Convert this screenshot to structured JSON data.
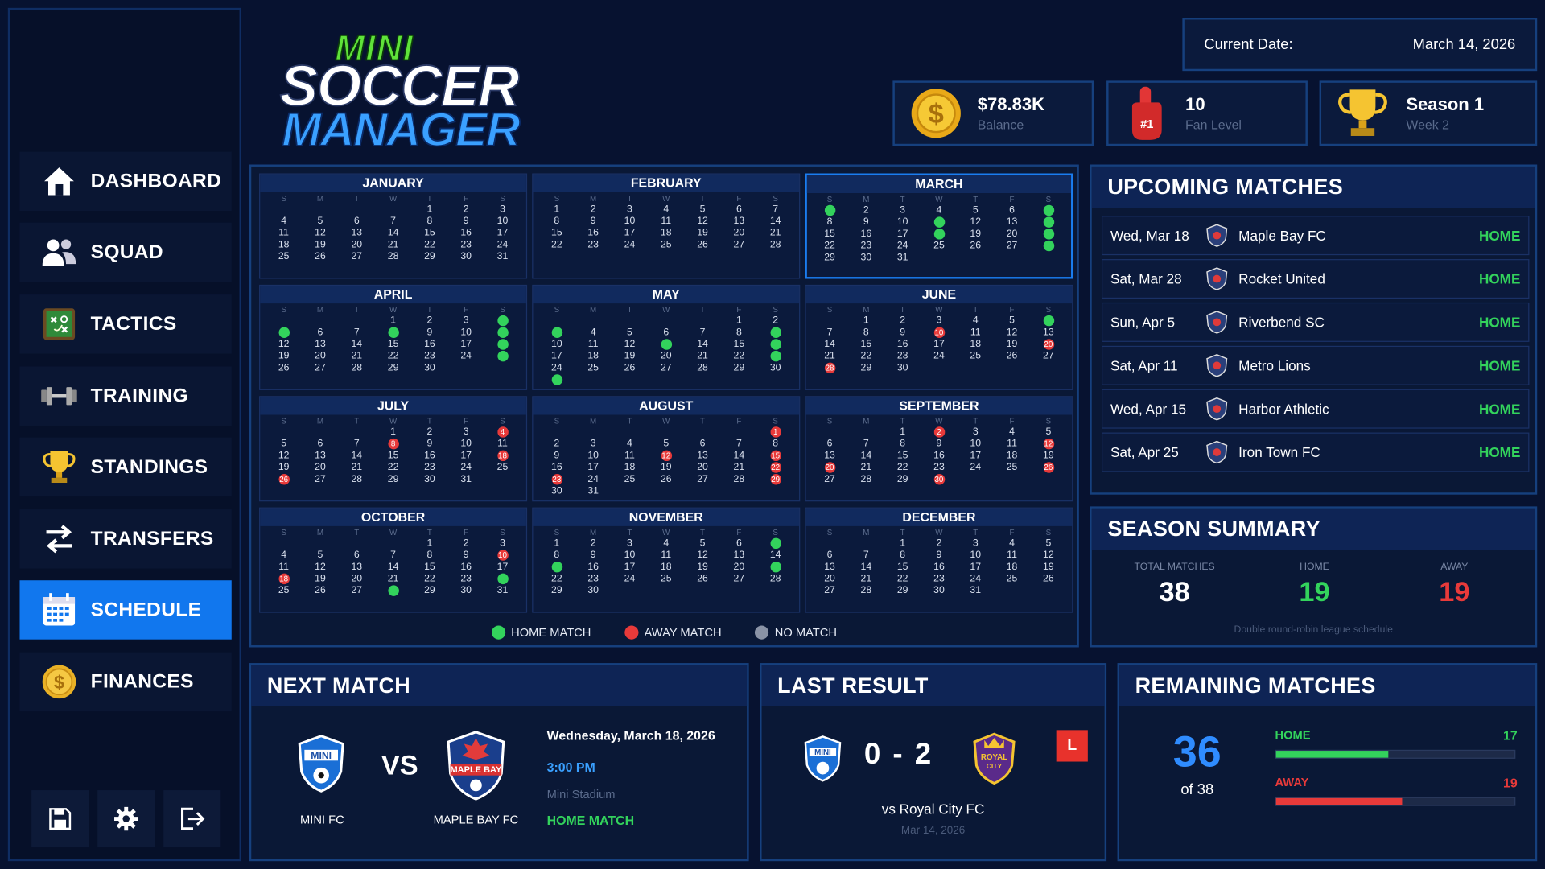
{
  "logo": {
    "line1": "MINI",
    "line2": "SOCCER",
    "line3": "MANAGER"
  },
  "nav": [
    {
      "label": "DASHBOARD",
      "icon": "home-icon"
    },
    {
      "label": "SQUAD",
      "icon": "people-icon"
    },
    {
      "label": "TACTICS",
      "icon": "tactics-board-icon"
    },
    {
      "label": "TRAINING",
      "icon": "dumbbell-icon"
    },
    {
      "label": "STANDINGS",
      "icon": "trophy-icon"
    },
    {
      "label": "TRANSFERS",
      "icon": "transfer-arrows-icon"
    },
    {
      "label": "SCHEDULE",
      "icon": "calendar-icon",
      "active": true
    },
    {
      "label": "FINANCES",
      "icon": "coin-icon"
    }
  ],
  "bottom_buttons": [
    "save-icon",
    "gear-icon",
    "exit-icon"
  ],
  "header": {
    "date_label": "Current Date:",
    "date_value": "March 14, 2026",
    "balance": {
      "value": "$78.83K",
      "label": "Balance"
    },
    "fan": {
      "value": "10",
      "label": "Fan Level",
      "badge": "#1"
    },
    "season": {
      "value": "Season 1",
      "label": "Week 2"
    }
  },
  "calendar": {
    "weekdays": [
      "S",
      "M",
      "T",
      "W",
      "T",
      "F",
      "S"
    ],
    "months": [
      {
        "name": "JANUARY",
        "start": 4,
        "days": 31,
        "home": [],
        "away": []
      },
      {
        "name": "FEBRUARY",
        "start": 0,
        "days": 28,
        "home": [],
        "away": []
      },
      {
        "name": "MARCH",
        "start": 0,
        "days": 31,
        "home": [
          1,
          7,
          11,
          14,
          18,
          21,
          28
        ],
        "away": [],
        "selected": true
      },
      {
        "name": "APRIL",
        "start": 3,
        "days": 30,
        "home": [
          5,
          4,
          8,
          11,
          18,
          25
        ],
        "away": []
      },
      {
        "name": "MAY",
        "start": 5,
        "days": 31,
        "home": [
          3,
          9,
          13,
          16,
          23,
          31
        ],
        "away": []
      },
      {
        "name": "JUNE",
        "start": 1,
        "days": 30,
        "home": [
          6
        ],
        "away": [
          10,
          20,
          28
        ]
      },
      {
        "name": "JULY",
        "start": 3,
        "days": 31,
        "home": [],
        "away": [
          4,
          8,
          18,
          26
        ]
      },
      {
        "name": "AUGUST",
        "start": 6,
        "days": 31,
        "home": [],
        "away": [
          1,
          12,
          15,
          22,
          23,
          29
        ]
      },
      {
        "name": "SEPTEMBER",
        "start": 2,
        "days": 30,
        "home": [],
        "away": [
          2,
          12,
          20,
          26,
          30
        ]
      },
      {
        "name": "OCTOBER",
        "start": 4,
        "days": 31,
        "home": [
          24,
          28
        ],
        "away": [
          10,
          18
        ]
      },
      {
        "name": "NOVEMBER",
        "start": 0,
        "days": 30,
        "home": [
          7,
          15,
          21
        ],
        "away": []
      },
      {
        "name": "DECEMBER",
        "start": 2,
        "days": 31,
        "home": [],
        "away": []
      }
    ],
    "legend": {
      "home": "HOME MATCH",
      "away": "AWAY MATCH",
      "none": "NO MATCH"
    },
    "colors": {
      "home": "#33d35c",
      "away": "#e83a3a",
      "none": "#8a93a6"
    }
  },
  "upcoming": {
    "title": "UPCOMING MATCHES",
    "matches": [
      {
        "date": "Wed, Mar 18",
        "opponent": "Maple Bay FC",
        "venue": "HOME"
      },
      {
        "date": "Sat, Mar 28",
        "opponent": "Rocket United",
        "venue": "HOME"
      },
      {
        "date": "Sun, Apr 5",
        "opponent": "Riverbend SC",
        "venue": "HOME"
      },
      {
        "date": "Sat, Apr 11",
        "opponent": "Metro Lions",
        "venue": "HOME"
      },
      {
        "date": "Wed, Apr 15",
        "opponent": "Harbor Athletic",
        "venue": "HOME"
      },
      {
        "date": "Sat, Apr 25",
        "opponent": "Iron Town FC",
        "venue": "HOME"
      }
    ]
  },
  "summary": {
    "title": "SEASON SUMMARY",
    "total_label": "TOTAL MATCHES",
    "total": "38",
    "home_label": "HOME",
    "home": "19",
    "away_label": "AWAY",
    "away": "19",
    "note": "Double round-robin league schedule"
  },
  "next_match": {
    "title": "NEXT MATCH",
    "home_team": "MINI FC",
    "vs": "VS",
    "away_team": "MAPLE BAY FC",
    "date": "Wednesday, March 18, 2026",
    "time": "3:00 PM",
    "venue": "Mini Stadium",
    "type": "HOME MATCH"
  },
  "last_result": {
    "title": "LAST RESULT",
    "score": "0 - 2",
    "result": "L",
    "opponent": "vs Royal City FC",
    "date": "Mar 14, 2026"
  },
  "remaining": {
    "title": "REMAINING MATCHES",
    "count": "36",
    "of": "of 38",
    "home_label": "HOME",
    "home": "17",
    "home_fraction": 0.47,
    "away_label": "AWAY",
    "away": "19",
    "away_fraction": 0.53
  }
}
